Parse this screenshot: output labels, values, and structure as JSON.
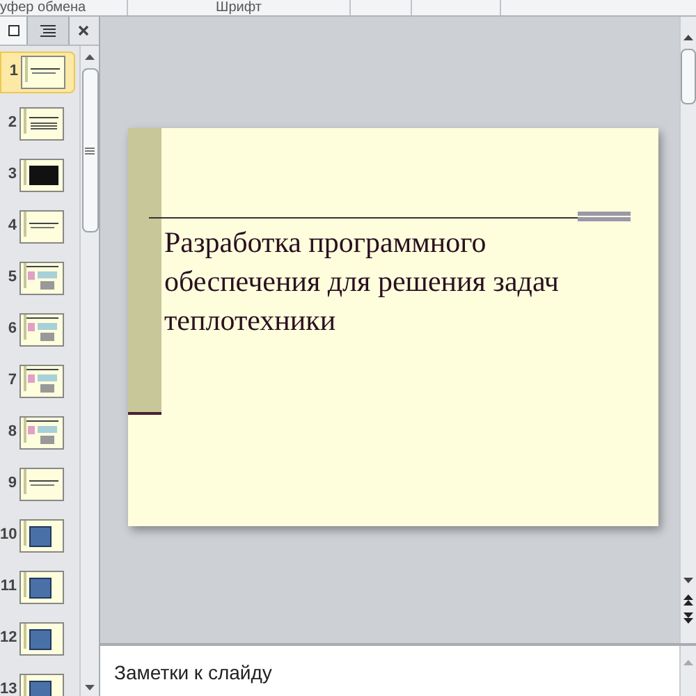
{
  "ribbon": {
    "groups": [
      "уфер обмена",
      "Шрифт"
    ]
  },
  "pane_tabs": [
    {
      "kind": "slides",
      "selected": true
    },
    {
      "kind": "outline",
      "selected": false
    }
  ],
  "thumbnails": [
    {
      "number": "1",
      "kind": "title",
      "selected": true
    },
    {
      "number": "2",
      "kind": "text",
      "selected": false
    },
    {
      "number": "3",
      "kind": "dark",
      "selected": false
    },
    {
      "number": "4",
      "kind": "title",
      "selected": false
    },
    {
      "number": "5",
      "kind": "diagram",
      "selected": false
    },
    {
      "number": "6",
      "kind": "diagram",
      "selected": false
    },
    {
      "number": "7",
      "kind": "diagram",
      "selected": false
    },
    {
      "number": "8",
      "kind": "diagram",
      "selected": false
    },
    {
      "number": "9",
      "kind": "title",
      "selected": false
    },
    {
      "number": "10",
      "kind": "scheme",
      "selected": false
    },
    {
      "number": "11",
      "kind": "scheme",
      "selected": false
    },
    {
      "number": "12",
      "kind": "scheme",
      "selected": false
    },
    {
      "number": "13",
      "kind": "scheme",
      "selected": false
    }
  ],
  "slide": {
    "title": "Разработка программного обеспечения для решения задач теплотехники"
  },
  "notes": {
    "placeholder": "Заметки к слайду"
  }
}
